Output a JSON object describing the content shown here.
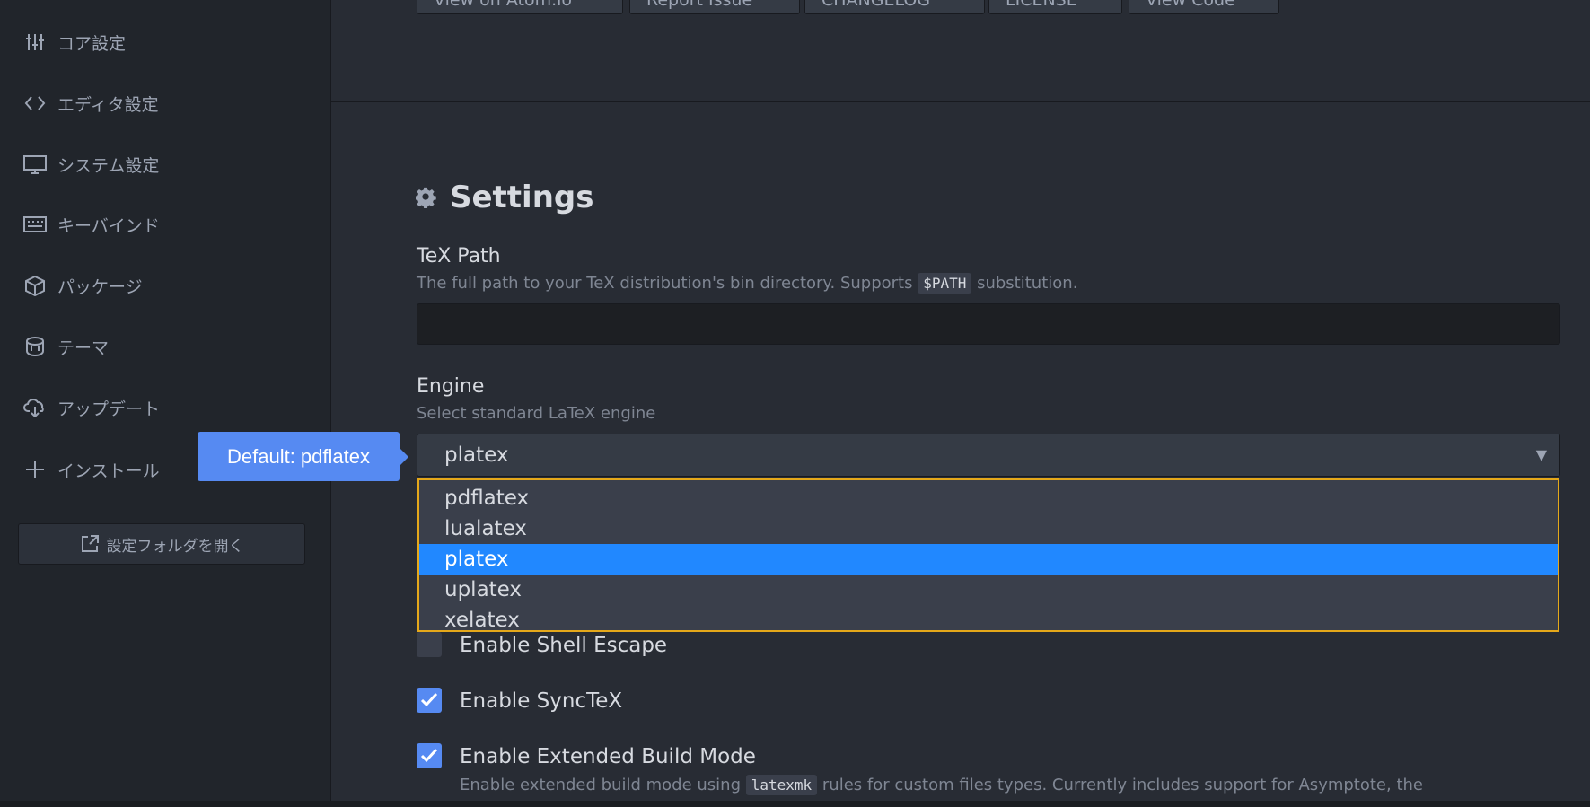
{
  "sidebar": {
    "items": [
      {
        "label": "コア設定",
        "icon": "sliders-icon"
      },
      {
        "label": "エディタ設定",
        "icon": "code-icon"
      },
      {
        "label": "システム設定",
        "icon": "monitor-icon"
      },
      {
        "label": "キーバインド",
        "icon": "keyboard-icon"
      },
      {
        "label": "パッケージ",
        "icon": "package-icon"
      },
      {
        "label": "テーマ",
        "icon": "paintcan-icon"
      },
      {
        "label": "アップデート",
        "icon": "cloud-download-icon"
      },
      {
        "label": "インストール",
        "icon": "plus-icon"
      }
    ],
    "open_folder_label": "設定フォルダを開く"
  },
  "top_buttons": [
    "View on Atom.io",
    "Report Issue",
    "CHANGELOG",
    "LICENSE",
    "View Code"
  ],
  "tooltip": "Default: pdflatex",
  "settings": {
    "title": "Settings",
    "tex_path": {
      "label": "TeX Path",
      "desc_before": "The full path to your TeX distribution's bin directory. Supports ",
      "desc_code": "$PATH",
      "desc_after": " substitution.",
      "value": ""
    },
    "engine": {
      "label": "Engine",
      "desc": "Select standard LaTeX engine",
      "selected": "platex",
      "options": [
        "pdflatex",
        "lualatex",
        "platex",
        "uplatex",
        "xelatex"
      ]
    },
    "checkboxes": [
      {
        "label": "Enable Shell Escape",
        "checked": false
      },
      {
        "label": "Enable SyncTeX",
        "checked": true
      },
      {
        "label": "Enable Extended Build Mode",
        "checked": true
      }
    ],
    "extended_desc_before": "Enable extended build mode using ",
    "extended_desc_code": "latexmk",
    "extended_desc_after": " rules for custom files types. Currently includes support for Asymptote, the"
  },
  "colors": {
    "accent": "#568af2",
    "selected_option": "#2188ff",
    "focus_border": "#e5a81a"
  }
}
